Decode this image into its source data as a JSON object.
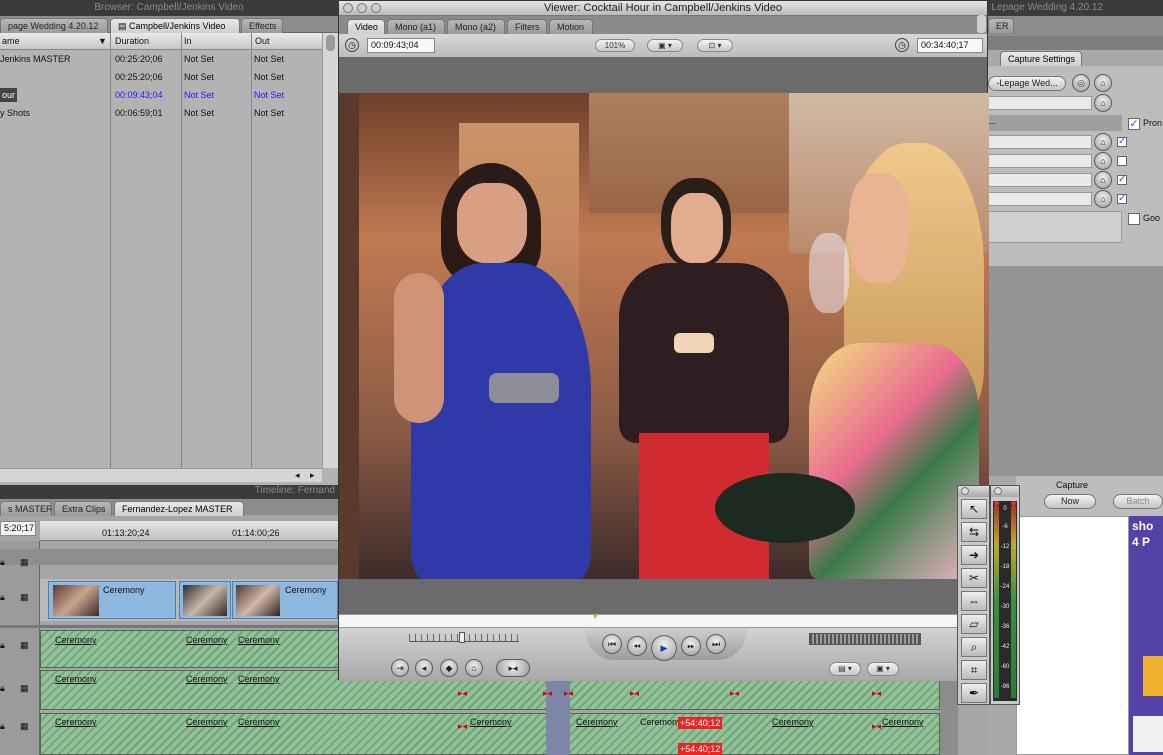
{
  "browser": {
    "title": "Browser: Campbell/Jenkins Video",
    "tabs": [
      "page Wedding 4.20.12",
      "Campbell/Jenkins Video",
      "Effects"
    ],
    "columns": [
      "ame",
      "Duration",
      "In",
      "Out"
    ],
    "rows": [
      {
        "name": "Jenkins MASTER",
        "duration": "00:25:20;06",
        "in": "Not Set",
        "out": "Not Set"
      },
      {
        "name": "",
        "duration": "00:25:20;06",
        "in": "Not Set",
        "out": "Not Set"
      },
      {
        "name": "our",
        "duration": "00:09:43;04",
        "in": "Not Set",
        "out": "Not Set"
      },
      {
        "name": "y Shots",
        "duration": "00:06:59;01",
        "in": "Not Set",
        "out": "Not Set"
      }
    ]
  },
  "viewer": {
    "title": "Viewer: Cocktail Hour in Campbell/Jenkins Video",
    "tabs": [
      "Video",
      "Mono (a1)",
      "Mono (a2)",
      "Filters",
      "Motion"
    ],
    "duration_tc": "00:09:43;04",
    "zoom": "101%",
    "current_tc": "00:34:40;17",
    "playhead_fraction": 0.38,
    "colors": {
      "frame_bg": "#6b6b6b"
    }
  },
  "right_panel": {
    "title": "Lepage Wedding 4.20.12",
    "tab_top": "ER",
    "tab": "Capture Settings",
    "project_button": "-Lepage Wed...",
    "prompt_label": "Pron",
    "good_label": "Goo",
    "capture_label": "Capture",
    "now_button": "Now",
    "batch_button": "Batch",
    "side_text": [
      "sho",
      "4 P"
    ]
  },
  "timeline": {
    "title": "Timeline: Fernand",
    "tabs": [
      "s MASTER",
      "Extra Clips",
      "Fernandez-Lopez MASTER"
    ],
    "current_tc": "5:20;17",
    "ruler": [
      "01:13:20;24",
      "01:14:00;26"
    ],
    "video_clips": [
      "Ceremony",
      "",
      "Ceremony"
    ],
    "audio_label": "Ceremony",
    "red_label": "+54:40;12"
  },
  "meter": {
    "scale": [
      "0",
      "-6",
      "-12",
      "-18",
      "-24",
      "-30",
      "-36",
      "-42",
      "-60",
      "-96"
    ]
  },
  "tools": [
    "arrow-icon",
    "select-track-icon",
    "edit-icon",
    "razor-icon",
    "slip-icon",
    "pen-slide-icon",
    "zoom-icon",
    "crop-icon",
    "pen-icon"
  ]
}
